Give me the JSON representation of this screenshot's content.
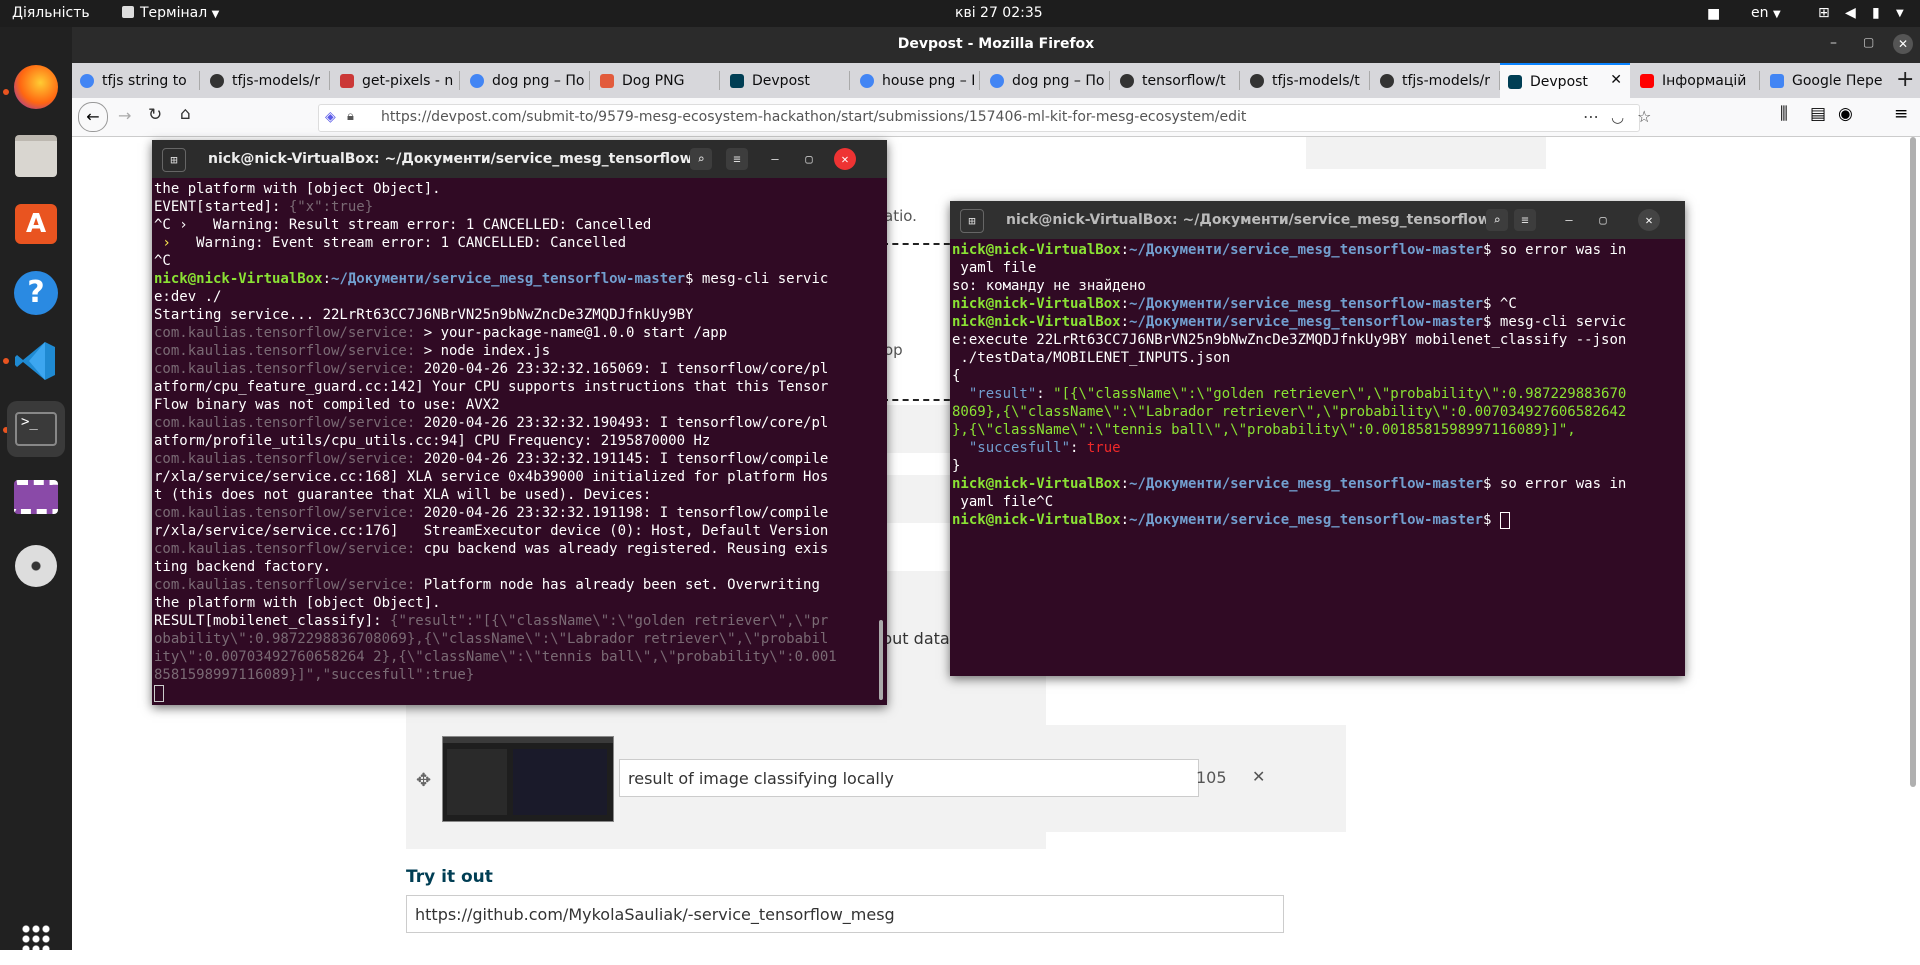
{
  "topbar": {
    "activities": "Діяльність",
    "app_menu": "Термінал",
    "clock": "кві 27  02:35",
    "lang": "en"
  },
  "firefox": {
    "window_title": "Devpost - Mozilla Firefox",
    "url_host": "https://devpost.com",
    "url_path": "/submit-to/9579-mesg-ecosystem-hackathon/start/submissions/157406-ml-kit-for-mesg-ecosystem/edit",
    "tabs": [
      {
        "label": "tfjs string to"
      },
      {
        "label": "tfjs-models/r"
      },
      {
        "label": "get-pixels - n"
      },
      {
        "label": "dog png – По"
      },
      {
        "label": "Dog PNG"
      },
      {
        "label": "Devpost"
      },
      {
        "label": "house png – I"
      },
      {
        "label": "dog png – По"
      },
      {
        "label": "tensorflow/t"
      },
      {
        "label": "tfjs-models/t"
      },
      {
        "label": "tfjs-models/r"
      },
      {
        "label": "Devpost"
      },
      {
        "label": "Інформацій"
      },
      {
        "label": "Google Пере"
      }
    ]
  },
  "page": {
    "frag_ratio": "atio.",
    "frag_op": "op",
    "frag_input": "put data",
    "caption_value": "result of image classifying locally",
    "char_count": "105",
    "try_heading": "Try it out",
    "try_url": "https://github.com/MykolaSauliak/-service_tensorflow_mesg"
  },
  "terminal_left": {
    "title": "nick@nick-VirtualBox: ~/Документи/service_mesg_tensorflow...",
    "lines": {
      "l1": "the platform with [object Object].",
      "l2a": "EVENT[started]: ",
      "l2b": "{\"x\":true}",
      "l3a": "^C ›   ",
      "l3b": "Warning: Result stream error: 1 CANCELLED: Cancelled",
      "l4a": " ›   ",
      "l4b": "Warning: Event stream error: 1 CANCELLED: Cancelled",
      "l5": "^C",
      "l6user": "nick@nick-VirtualBox",
      "l6path": "~/Документи/service_mesg_tensorflow-master",
      "l6cmd": "$ mesg-cli servic",
      "l7": "e:dev ./",
      "l8": "Starting service... 22LrRt63CC7J6NBrVN25n9bNwZncDe3ZMQDJfnkUy9BY",
      "l9a": "com.kaulias.tensorflow/service: ",
      "l9b": "> your-package-name@1.0.0 start /app",
      "l10a": "com.kaulias.tensorflow/service: ",
      "l10b": "> node index.js",
      "l11a": "com.kaulias.tensorflow/service: ",
      "l11b": "2020-04-26 23:32:32.165069: I tensorflow/core/pl",
      "l12": "atform/cpu_feature_guard.cc:142] Your CPU supports instructions that this Tensor",
      "l13": "Flow binary was not compiled to use: AVX2",
      "l14a": "com.kaulias.tensorflow/service: ",
      "l14b": "2020-04-26 23:32:32.190493: I tensorflow/core/pl",
      "l15": "atform/profile_utils/cpu_utils.cc:94] CPU Frequency: 2195870000 Hz",
      "l16a": "com.kaulias.tensorflow/service: ",
      "l16b": "2020-04-26 23:32:32.191145: I tensorflow/compile",
      "l17": "r/xla/service/service.cc:168] XLA service 0x4b39000 initialized for platform Hos",
      "l18": "t (this does not guarantee that XLA will be used). Devices:",
      "l19a": "com.kaulias.tensorflow/service: ",
      "l19b": "2020-04-26 23:32:32.191198: I tensorflow/compile",
      "l20": "r/xla/service/service.cc:176]   StreamExecutor device (0): Host, Default Version",
      "l21a": "com.kaulias.tensorflow/service: ",
      "l21b": "cpu backend was already registered. Reusing exis",
      "l22": "ting backend factory.",
      "l23a": "com.kaulias.tensorflow/service: ",
      "l23b": "Platform node has already been set. Overwriting",
      "l24": "the platform with [object Object].",
      "l25a": "RESULT[mobilenet_classify]: ",
      "l25b": "{\"result\":\"[{\\\"className\\\":\\\"golden retriever\\\",\\\"pr",
      "l26": "obability\\\":0.9872298836708069},{\\\"className\\\":\\\"Labrador retriever\\\",\\\"probabil",
      "l27": "ity\\\":0.00703492760658264 2},{\\\"className\\\":\\\"tennis ball\\\",\\\"probability\\\":0.001",
      "l28": "8581598997116089}]\",\"succesfull\":true}"
    }
  },
  "terminal_right": {
    "title": "nick@nick-VirtualBox: ~/Документи/service_mesg_tensorflow...",
    "user": "nick@nick-VirtualBox",
    "path": "~/Документи/service_mesg_tensorflow-master",
    "lines": {
      "r1cmd": "$ so error was in",
      "r2": " yaml file",
      "r3": "so: команду не знайдено",
      "r4cmd": "$ ^C",
      "r5cmd": "$ mesg-cli servic",
      "r6": "e:execute 22LrRt63CC7J6NBrVN25n9bNwZncDe3ZMQDJfnkUy9BY mobilenet_classify --json",
      "r7": " ./testData/MOBILENET_INPUTS.json",
      "r8": "{",
      "r9a": "  \"result\"",
      "r9b": ": ",
      "r9c": "\"[{\\\"className\\\":\\\"golden retriever\\\",\\\"probability\\\":0.987229883670",
      "r10": "8069},{\\\"className\\\":\\\"Labrador retriever\\\",\\\"probability\\\":0.007034927606582642",
      "r11": "},{\\\"className\\\":\\\"tennis ball\\\",\\\"probability\\\":0.0018581598997116089}]\",",
      "r12a": "  \"succesfull\"",
      "r12b": ": ",
      "r12c": "true",
      "r13": "}",
      "r14cmd": "$ so error was in",
      "r15": " yaml file^C",
      "r16cmd": "$ "
    }
  }
}
